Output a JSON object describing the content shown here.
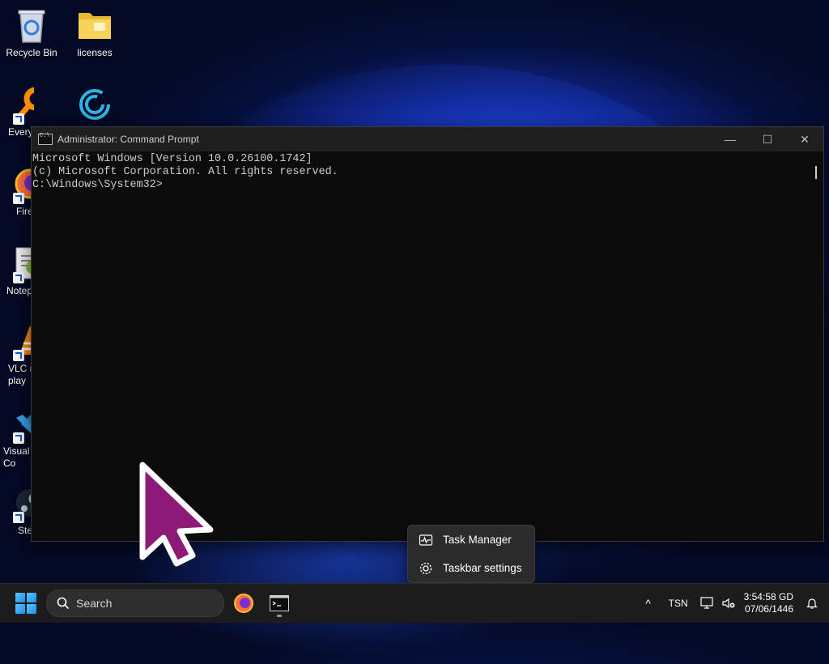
{
  "desktop": {
    "icons": [
      {
        "label": "Recycle Bin",
        "icon": "recycle-bin-icon"
      },
      {
        "label": "licenses",
        "icon": "folder-icon"
      },
      {
        "label": "Every",
        "icon": "everything-search-icon"
      },
      {
        "label": "",
        "icon": "ring-app-icon"
      },
      {
        "label": "Fire",
        "icon": "firefox-icon"
      },
      {
        "label": "Notep",
        "icon": "notepad-plus-icon"
      },
      {
        "label": "VLC m\nplay",
        "icon": "vlc-icon"
      },
      {
        "label": "Visual\nCo",
        "icon": "vscode-icon"
      },
      {
        "label": "Ste",
        "icon": "steam-icon"
      }
    ]
  },
  "cmd": {
    "title": "Administrator: Command Prompt",
    "lines": [
      "Microsoft Windows [Version 10.0.26100.1742]",
      "(c) Microsoft Corporation. All rights reserved.",
      "",
      "C:\\Windows\\System32>"
    ],
    "minimize_glyph": "—",
    "maximize_glyph": "☐",
    "close_glyph": "✕"
  },
  "context_menu": {
    "items": [
      {
        "label": "Task Manager",
        "icon": "task-manager-icon"
      },
      {
        "label": "Taskbar settings",
        "icon": "gear-icon"
      }
    ]
  },
  "taskbar": {
    "search_placeholder": "Search",
    "tray": {
      "chevron": "^",
      "language": "TSN",
      "time": "3:54:58 GD",
      "date": "07/06/1446"
    }
  },
  "colors": {
    "cursor_fill": "#8e1a78",
    "cursor_outline": "#ffffff",
    "accent": "#1a8cf0"
  }
}
